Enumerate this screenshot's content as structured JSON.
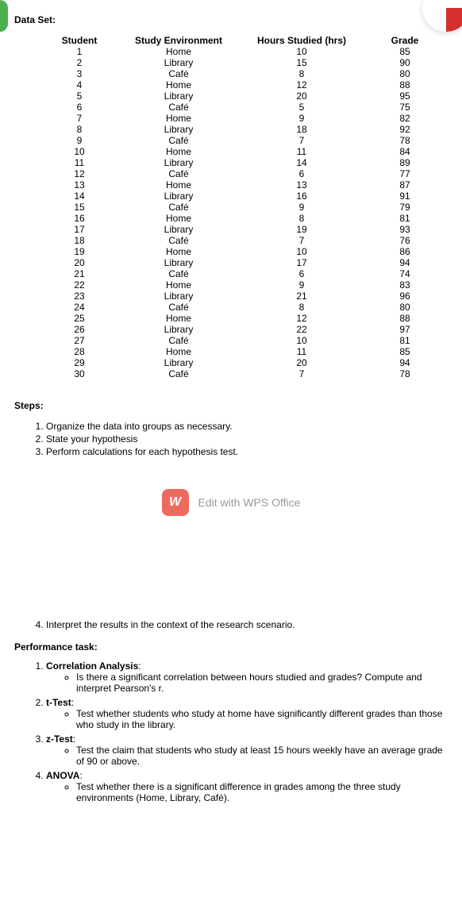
{
  "dataSetLabel": "Data Set:",
  "table": {
    "headers": {
      "student": "Student",
      "env": "Study Environment",
      "hours": "Hours Studied (hrs)",
      "grade": "Grade"
    },
    "rows": [
      {
        "student": "1",
        "env": "Home",
        "hours": "10",
        "grade": "85"
      },
      {
        "student": "2",
        "env": "Library",
        "hours": "15",
        "grade": "90"
      },
      {
        "student": "3",
        "env": "Café",
        "hours": "8",
        "grade": "80"
      },
      {
        "student": "4",
        "env": "Home",
        "hours": "12",
        "grade": "88"
      },
      {
        "student": "5",
        "env": "Library",
        "hours": "20",
        "grade": "95"
      },
      {
        "student": "6",
        "env": "Café",
        "hours": "5",
        "grade": "75"
      },
      {
        "student": "7",
        "env": "Home",
        "hours": "9",
        "grade": "82"
      },
      {
        "student": "8",
        "env": "Library",
        "hours": "18",
        "grade": "92"
      },
      {
        "student": "9",
        "env": "Café",
        "hours": "7",
        "grade": "78"
      },
      {
        "student": "10",
        "env": "Home",
        "hours": "11",
        "grade": "84"
      },
      {
        "student": "11",
        "env": "Library",
        "hours": "14",
        "grade": "89"
      },
      {
        "student": "12",
        "env": "Café",
        "hours": "6",
        "grade": "77"
      },
      {
        "student": "13",
        "env": "Home",
        "hours": "13",
        "grade": "87"
      },
      {
        "student": "14",
        "env": "Library",
        "hours": "16",
        "grade": "91"
      },
      {
        "student": "15",
        "env": "Café",
        "hours": "9",
        "grade": "79"
      },
      {
        "student": "16",
        "env": "Home",
        "hours": "8",
        "grade": "81"
      },
      {
        "student": "17",
        "env": "Library",
        "hours": "19",
        "grade": "93"
      },
      {
        "student": "18",
        "env": "Café",
        "hours": "7",
        "grade": "76"
      },
      {
        "student": "19",
        "env": "Home",
        "hours": "10",
        "grade": "86"
      },
      {
        "student": "20",
        "env": "Library",
        "hours": "17",
        "grade": "94"
      },
      {
        "student": "21",
        "env": "Café",
        "hours": "6",
        "grade": "74"
      },
      {
        "student": "22",
        "env": "Home",
        "hours": "9",
        "grade": "83"
      },
      {
        "student": "23",
        "env": "Library",
        "hours": "21",
        "grade": "96"
      },
      {
        "student": "24",
        "env": "Café",
        "hours": "8",
        "grade": "80"
      },
      {
        "student": "25",
        "env": "Home",
        "hours": "12",
        "grade": "88"
      },
      {
        "student": "26",
        "env": "Library",
        "hours": "22",
        "grade": "97"
      },
      {
        "student": "27",
        "env": "Café",
        "hours": "10",
        "grade": "81"
      },
      {
        "student": "28",
        "env": "Home",
        "hours": "11",
        "grade": "85"
      },
      {
        "student": "29",
        "env": "Library",
        "hours": "20",
        "grade": "94"
      },
      {
        "student": "30",
        "env": "Café",
        "hours": "7",
        "grade": "78"
      }
    ]
  },
  "stepsLabel": "Steps:",
  "steps": [
    "Organize the data into groups as necessary.",
    "State your hypothesis",
    "Perform calculations for each hypothesis test."
  ],
  "wps": {
    "iconText": "W",
    "label": "Edit with WPS Office"
  },
  "step4": "Interpret the results in the context of the research scenario.",
  "perfLabel": "Performance task:",
  "perf": [
    {
      "title": "Correlation Analysis",
      "sub": [
        "Is there a significant correlation between hours studied and grades? Compute and interpret Pearson's r."
      ]
    },
    {
      "title": "t-Test",
      "sub": [
        "Test whether students who study at home have significantly different grades than those who study in the library."
      ]
    },
    {
      "title": "z-Test",
      "sub": [
        "Test the claim that students who study at least 15 hours weekly have an average grade of 90 or above."
      ]
    },
    {
      "title": "ANOVA",
      "sub": [
        "Test whether there is a significant difference in grades among the three study environments (Home, Library, Café)."
      ]
    }
  ]
}
